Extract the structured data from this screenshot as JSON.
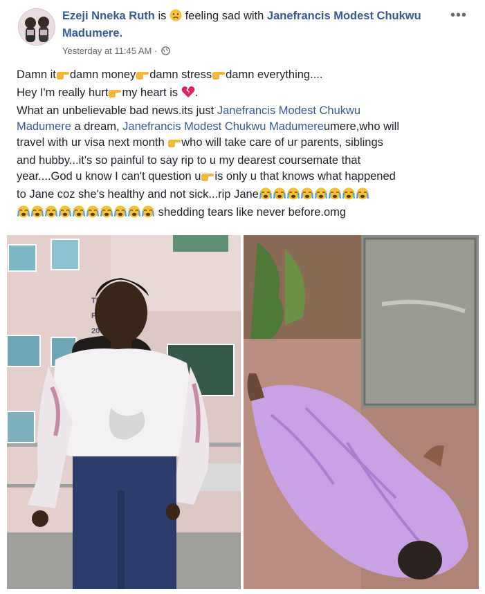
{
  "post": {
    "author": "Ezeji Nneka Ruth",
    "is_word": "is",
    "feeling_text": "feeling sad with",
    "tagged_name": "Janefrancis Modest Chukwu Madumere.",
    "timestamp": "Yesterday at 11:45 AM ·",
    "more_label": "•••",
    "body": {
      "line1_a": "Damn it",
      "line1_b": "damn money",
      "line1_c": "damn stress",
      "line1_d": "damn everything....",
      "line2_a": "Hey I'm really hurt",
      "line2_b": "my heart is",
      "line2_c": ".",
      "line3_a": "What an unbelievable bad news.its just ",
      "line3_mention": "Janefrancis Modest Chukwu",
      "line4_mention": "Madumere",
      "line4_a": " a dream, ",
      "line4_mention2": "Janefrancis Modest Chukwu Madumere",
      "line4_b": "umere,who will",
      "line5_a": "travel with ur visa next month",
      "line5_b": "who will take care of ur parents, siblings",
      "line6": "and hubby...it's so painful to say rip to u my dearest coursemate that",
      "line7_a": "year....God u know I can't question u",
      "line7_b": "is only u that knows what happened",
      "line8": "to Jane coz she's healthy and not sick...rip Jane",
      "line9": " shedding tears like never before.omg"
    },
    "photos": {
      "left_sign_1": "TET",
      "left_sign_2": "PRO",
      "left_sign_3": "201"
    }
  },
  "colors": {
    "link": "#385898",
    "text": "#1d2129",
    "meta": "#616770"
  },
  "icons": {
    "sad_emoji": "sad-face-emoji",
    "point_right": "backhand-index-pointing-right",
    "broken_heart": "broken-heart",
    "crying": "loudly-crying-face",
    "globe": "globe-icon"
  }
}
